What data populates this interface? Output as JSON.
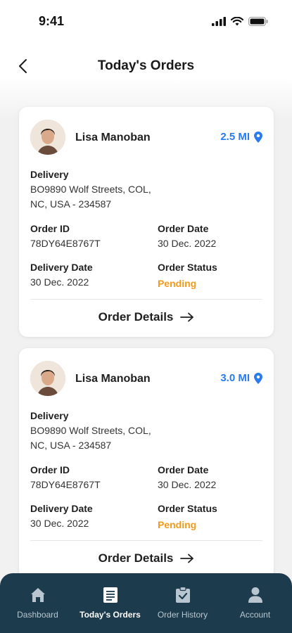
{
  "status_bar": {
    "time": "9:41"
  },
  "header": {
    "title": "Today's Orders"
  },
  "orders": [
    {
      "customer_name": "Lisa Manoban",
      "distance": "2.5 MI",
      "delivery_label": "Delivery",
      "address_line1": "BO9890 Wolf Streets, COL,",
      "address_line2": "NC, USA - 234587",
      "order_id_label": "Order ID",
      "order_id": "78DY64E8767T",
      "order_date_label": "Order Date",
      "order_date": "30 Dec. 2022",
      "delivery_date_label": "Delivery Date",
      "delivery_date": "30 Dec. 2022",
      "order_status_label": "Order Status",
      "order_status": "Pending",
      "details_label": "Order Details"
    },
    {
      "customer_name": "Lisa Manoban",
      "distance": "3.0 MI",
      "delivery_label": "Delivery",
      "address_line1": "BO9890 Wolf Streets, COL,",
      "address_line2": "NC, USA - 234587",
      "order_id_label": "Order ID",
      "order_id": "78DY64E8767T",
      "order_date_label": "Order Date",
      "order_date": "30 Dec. 2022",
      "delivery_date_label": "Delivery Date",
      "delivery_date": "30 Dec. 2022",
      "order_status_label": "Order Status",
      "order_status": "Pending",
      "details_label": "Order Details"
    }
  ],
  "bottom_nav": {
    "items": [
      {
        "label": "Dashboard",
        "icon": "home-icon"
      },
      {
        "label": "Today's Orders",
        "icon": "clipboard-list-icon",
        "active": true
      },
      {
        "label": "Order History",
        "icon": "clipboard-check-icon"
      },
      {
        "label": "Account",
        "icon": "user-icon"
      }
    ]
  },
  "colors": {
    "accent": "#2b7bf0",
    "pending": "#f39a1c",
    "nav_bg": "#1c3b4d"
  }
}
